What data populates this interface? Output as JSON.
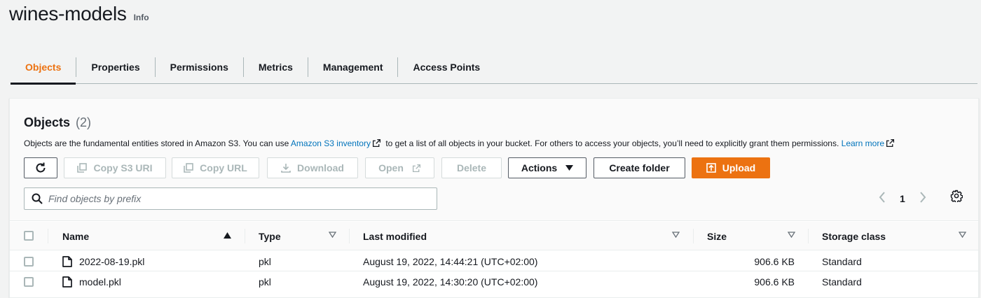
{
  "header": {
    "title": "wines-models",
    "info": "Info"
  },
  "tabs": [
    {
      "label": "Objects",
      "active": true
    },
    {
      "label": "Properties"
    },
    {
      "label": "Permissions"
    },
    {
      "label": "Metrics"
    },
    {
      "label": "Management"
    },
    {
      "label": "Access Points"
    }
  ],
  "objects": {
    "title": "Objects",
    "count": "(2)",
    "description": {
      "part1": "Objects are the fundamental entities stored in Amazon S3. You can use",
      "inventory_link": "Amazon S3 inventory",
      "part2": "to get a list of all objects in your bucket. For others to access your objects, you’ll need to explicitly grant them permissions.",
      "learn_more": "Learn more"
    }
  },
  "toolbar": {
    "refresh_icon": "refresh-icon",
    "copy_s3_uri": "Copy S3 URI",
    "copy_url": "Copy URL",
    "download": "Download",
    "open": "Open",
    "delete": "Delete",
    "actions": "Actions",
    "create_folder": "Create folder",
    "upload": "Upload"
  },
  "search": {
    "placeholder": "Find objects by prefix",
    "value": ""
  },
  "pagination": {
    "page": "1"
  },
  "table": {
    "columns": [
      "Name",
      "Type",
      "Last modified",
      "Size",
      "Storage class"
    ],
    "rows": [
      {
        "name": "2022-08-19.pkl",
        "type": "pkl",
        "last_modified": "August 19, 2022, 14:44:21 (UTC+02:00)",
        "size": "906.6 KB",
        "storage_class": "Standard"
      },
      {
        "name": "model.pkl",
        "type": "pkl",
        "last_modified": "August 19, 2022, 14:30:20 (UTC+02:00)",
        "size": "906.6 KB",
        "storage_class": "Standard"
      }
    ]
  },
  "colors": {
    "accent": "#ec7211",
    "link": "#0073bb",
    "text": "#16191f",
    "muted": "#687078",
    "disabled": "#aab7b8"
  }
}
